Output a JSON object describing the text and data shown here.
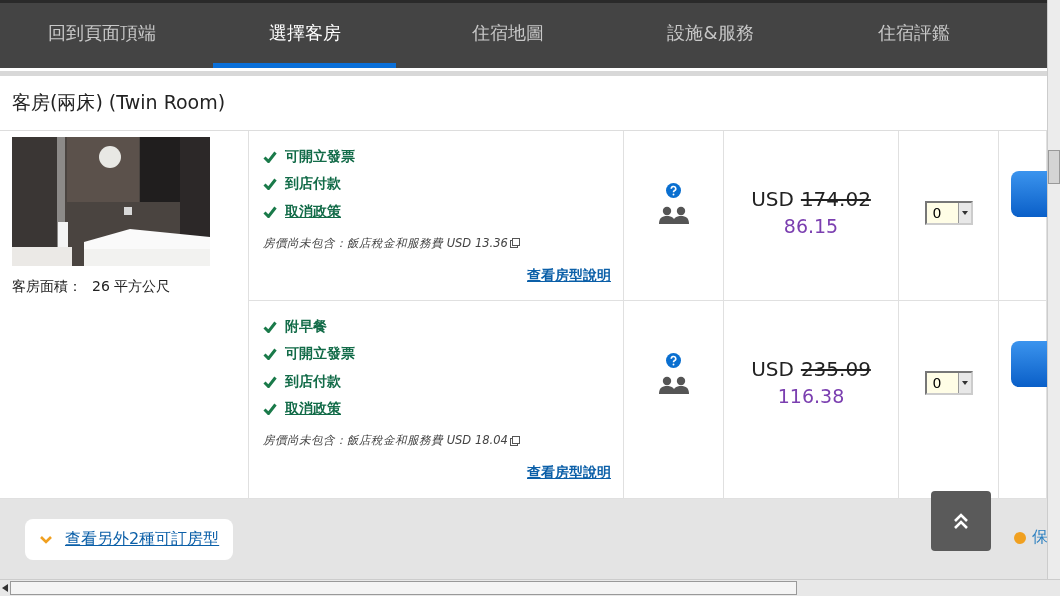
{
  "nav": {
    "tabs": [
      {
        "label": "回到頁面頂端",
        "selected": false
      },
      {
        "label": "選擇客房",
        "selected": true
      },
      {
        "label": "住宿地圖",
        "selected": false
      },
      {
        "label": "設施&服務",
        "selected": false
      },
      {
        "label": "住宿評鑑",
        "selected": false
      }
    ]
  },
  "room": {
    "title": "客房(兩床) (Twin Room)",
    "area_label": "客房面積：",
    "area_value": "26 平方公尺",
    "options": [
      {
        "features": [
          {
            "label": "可開立發票",
            "kind": "text"
          },
          {
            "label": "到店付款",
            "kind": "text"
          },
          {
            "label": "取消政策",
            "kind": "link"
          }
        ],
        "tax_note": "房價尚未包含：飯店稅金和服務費 USD 13.36",
        "details_link": "查看房型說明",
        "currency": "USD",
        "original_price": "174.02",
        "price": "86.15",
        "quantity": "0"
      },
      {
        "features": [
          {
            "label": "附早餐",
            "kind": "text"
          },
          {
            "label": "可開立發票",
            "kind": "text"
          },
          {
            "label": "到店付款",
            "kind": "text"
          },
          {
            "label": "取消政策",
            "kind": "link"
          }
        ],
        "tax_note": "房價尚未包含：飯店稅金和服務費 USD 18.04",
        "details_link": "查看房型說明",
        "currency": "USD",
        "original_price": "235.09",
        "price": "116.38",
        "quantity": "0"
      }
    ]
  },
  "more_rooms_link": "查看另外2種可訂房型",
  "side_text": "保"
}
